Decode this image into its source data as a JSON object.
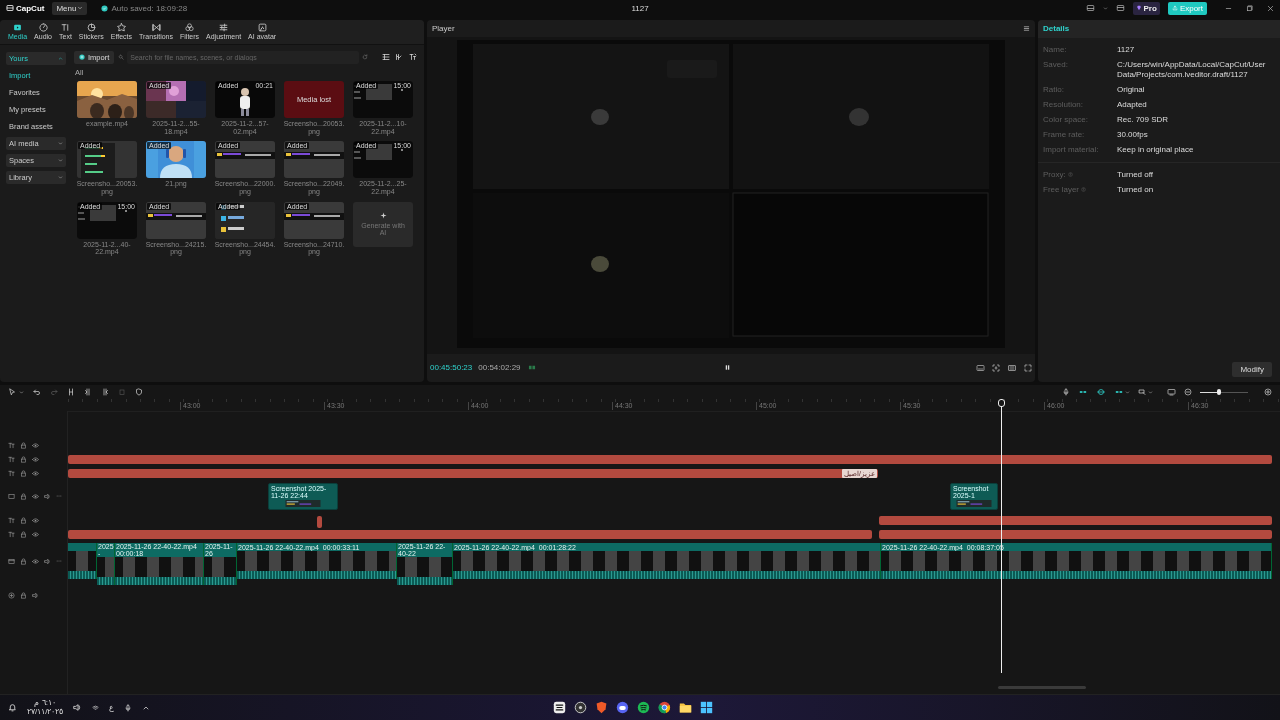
{
  "title_bar": {
    "logo": "CapCut",
    "menu": "Menu",
    "autosave": "Auto saved: 18:09:28",
    "project": "1127",
    "pro": "Pro",
    "export": "Export"
  },
  "tool_tabs": [
    {
      "label": "Media",
      "selected": true
    },
    {
      "label": "Audio",
      "selected": false
    },
    {
      "label": "Text",
      "selected": false
    },
    {
      "label": "Stickers",
      "selected": false
    },
    {
      "label": "Effects",
      "selected": false
    },
    {
      "label": "Transitions",
      "selected": false
    },
    {
      "label": "Filters",
      "selected": false
    },
    {
      "label": "Adjustment",
      "selected": false
    },
    {
      "label": "AI avatar",
      "selected": false
    }
  ],
  "sidebar": [
    {
      "kind": "group",
      "label": "Yours",
      "expanded": true
    },
    {
      "kind": "item",
      "label": "Import",
      "selected": true
    },
    {
      "kind": "item",
      "label": "Favorites",
      "selected": false
    },
    {
      "kind": "item",
      "label": "My presets",
      "selected": false
    },
    {
      "kind": "item",
      "label": "Brand assets",
      "selected": false
    },
    {
      "kind": "group",
      "label": "AI media",
      "expanded": false
    },
    {
      "kind": "group",
      "label": "Spaces",
      "expanded": false
    },
    {
      "kind": "group",
      "label": "Library",
      "expanded": false
    }
  ],
  "media": {
    "import": "Import",
    "search": {
      "placeholder": "Search for file names, scenes, or dialogs"
    },
    "filter": "All",
    "items": [
      {
        "kind": "picture",
        "name": "example.mp4"
      },
      {
        "kind": "picture",
        "name": "2025-11-2...55-18.mp4",
        "badge": "Added"
      },
      {
        "kind": "picture",
        "name": "2025-11-2...57-02.mp4",
        "badge": "Added",
        "duration": "00:21"
      },
      {
        "kind": "lost",
        "name": "Screensho...20053.png",
        "status": "Media lost"
      },
      {
        "kind": "picture",
        "name": "2025-11-2...10-22.mp4",
        "badge": "Added",
        "duration": "15:00"
      },
      {
        "kind": "picture",
        "name": "Screensho...20053.png",
        "badge": "Added"
      },
      {
        "kind": "picture",
        "name": "21.png",
        "badge": "Added"
      },
      {
        "kind": "picture",
        "name": "Screensho...22000.png",
        "badge": "Added"
      },
      {
        "kind": "picture",
        "name": "Screensho...22049.png",
        "badge": "Added"
      },
      {
        "kind": "picture",
        "name": "2025-11-2...25-22.mp4",
        "badge": "Added",
        "duration": "15:00"
      },
      {
        "kind": "picture",
        "name": "2025-11-2...40-22.mp4",
        "badge": "Added",
        "duration": "15:00"
      },
      {
        "kind": "picture",
        "name": "Screensho...24215.png",
        "badge": "Added"
      },
      {
        "kind": "picture",
        "name": "Screensho...24454.png",
        "badge": "Added"
      },
      {
        "kind": "picture",
        "name": "Screensho...24710.png",
        "badge": "Added"
      },
      {
        "kind": "generate",
        "label": "Generate with AI"
      }
    ]
  },
  "player": {
    "title": "Player",
    "current_time": "00:45:50:23",
    "total_time": "00:54:02:29"
  },
  "details": {
    "title": "Details",
    "project_rows": [
      {
        "label": "Name:",
        "value": "1127"
      },
      {
        "label": "Saved:",
        "value": "C:/Users/win/AppData/Local/CapCut/User Data/Projects/com.lveditor.draft/1127"
      },
      {
        "label": "Ratio:",
        "value": "Original"
      },
      {
        "label": "Resolution:",
        "value": "Adapted"
      },
      {
        "label": "Color space:",
        "value": "Rec. 709 SDR"
      },
      {
        "label": "Frame rate:",
        "value": "30.00fps"
      },
      {
        "label": "Import material:",
        "value": "Keep in original place"
      }
    ],
    "option_rows": [
      {
        "label": "Proxy:",
        "value": "Turned off"
      },
      {
        "label": "Free layer",
        "value": "Turned on"
      }
    ],
    "button": "Modify"
  },
  "timeline": {
    "zoom": {
      "level": 0.4
    },
    "ruler": [
      "43:00",
      "43:30",
      "44:00",
      "44:30",
      "45:00",
      "45:30",
      "46:00",
      "46:30"
    ],
    "tracks": [
      {
        "kind": "text"
      },
      {
        "kind": "text"
      },
      {
        "kind": "text",
        "clips": [
          {
            "label": "عزيز/اصيل"
          }
        ]
      },
      {
        "kind": "overlay",
        "clips": [
          {
            "label": "Screenshot 2025-11-26 22:44"
          },
          {
            "label": "Screenshot 2025-1"
          }
        ]
      },
      {
        "kind": "text"
      },
      {
        "kind": "text"
      },
      {
        "kind": "video",
        "clips": [
          {
            "name": "2025-"
          },
          {
            "name": "2025-11-26 22-40-22.mp4",
            "duration": "00:00:18"
          },
          {
            "name": "2025-11-26"
          },
          {
            "name": "2025-11-26 22-40-22.mp4",
            "duration": "00:00:33:11"
          },
          {
            "name": "2025-11-26 22-40-22"
          },
          {
            "name": "2025-11-26 22-40-22.mp4",
            "duration": "00:01:28:22"
          },
          {
            "name": "2025-11-26 22-40-22.mp4",
            "duration": "00:08:37:05"
          }
        ]
      },
      {
        "kind": "audio"
      }
    ]
  },
  "taskbar": {
    "time": "٦:١٠ م",
    "date": "٢٧/١١/٢٠٢٥",
    "language": "ع"
  }
}
